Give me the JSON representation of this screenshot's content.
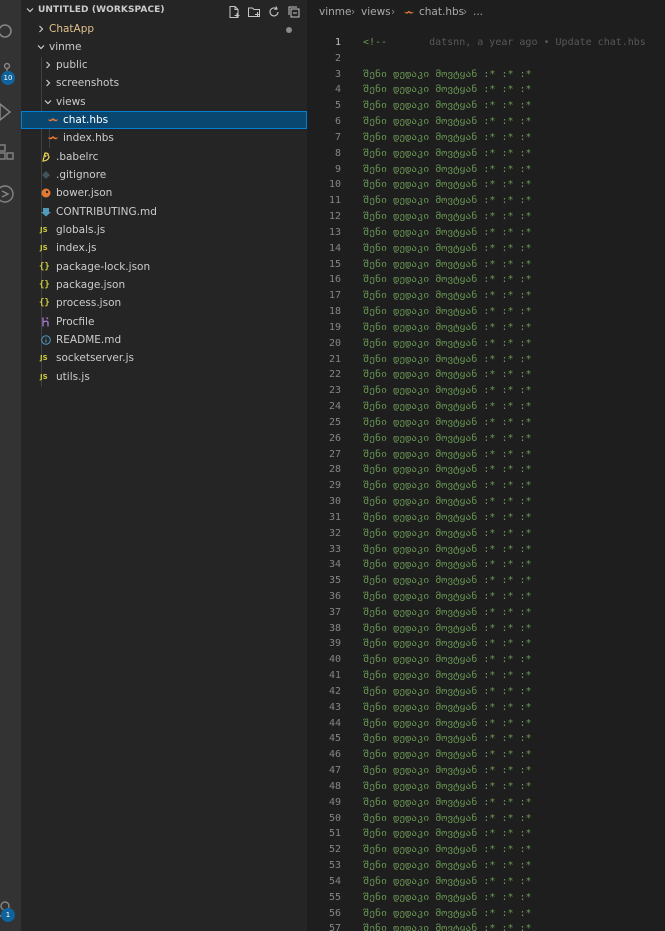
{
  "activity_bar": {
    "items": [
      {
        "icon": "search-icon"
      },
      {
        "icon": "source-control-icon",
        "badge": "10"
      },
      {
        "icon": "run-debug-icon"
      },
      {
        "icon": "extensions-icon"
      },
      {
        "icon": "remote-explorer-icon"
      },
      {
        "icon": "account-icon",
        "badge": "1"
      }
    ]
  },
  "explorer": {
    "workspace_title": "UNTITLED (WORKSPACE)",
    "header_actions": [
      "new-file-icon",
      "new-folder-icon",
      "refresh-icon",
      "collapse-all-icon"
    ],
    "tree": {
      "chatapp": "ChatApp",
      "vinme": "vinme",
      "public": "public",
      "screenshots": "screenshots",
      "views": "views",
      "chat_hbs": "chat.hbs",
      "index_hbs": "index.hbs",
      "babelrc": ".babelrc",
      "gitignore": ".gitignore",
      "bower_json": "bower.json",
      "contributing_md": "CONTRIBUTING.md",
      "globals_js": "globals.js",
      "index_js": "index.js",
      "package_lock_json": "package-lock.json",
      "package_json": "package.json",
      "process_json": "process.json",
      "procfile": "Procfile",
      "readme_md": "README.md",
      "socketserver_js": "socketserver.js",
      "utils_js": "utils.js"
    },
    "icon_glyphs": {
      "js": "JS",
      "json": "{}"
    }
  },
  "editor": {
    "breadcrumb": {
      "folder": "vinme",
      "subfolder": "views",
      "file": "chat.hbs",
      "more": "..."
    },
    "line1_code": "<!--",
    "line1_blame": "datsnn, a year ago • Update chat.hbs",
    "repeated_line_text": "შენი დედაკი მოვტყან :* :* :*",
    "first_line_number": 1,
    "last_visible_line_number": 57,
    "current_line": 1
  },
  "colors": {
    "comment_green": "#6a9955",
    "selection_bg": "#094771",
    "badge_blue": "#0e639c",
    "hbs_orange": "#e37933"
  }
}
